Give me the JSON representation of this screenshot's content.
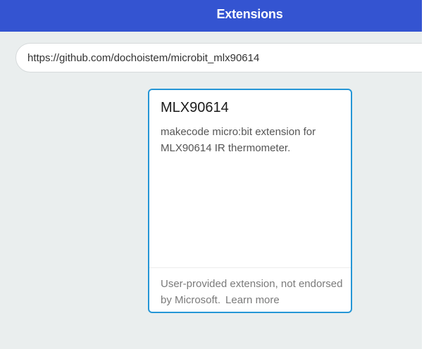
{
  "header": {
    "title": "Extensions",
    "background_color": "#3454d1"
  },
  "search": {
    "value": "https://github.com/dochoistem/microbit_mlx90614",
    "placeholder": ""
  },
  "results": [
    {
      "title": "MLX90614",
      "description": "makecode micro:bit extension for MLX90614 IR thermometer.",
      "footer_text": "User-provided extension, not endorsed by Microsoft.",
      "footer_link": "Learn more",
      "border_color": "#2596d6"
    }
  ]
}
